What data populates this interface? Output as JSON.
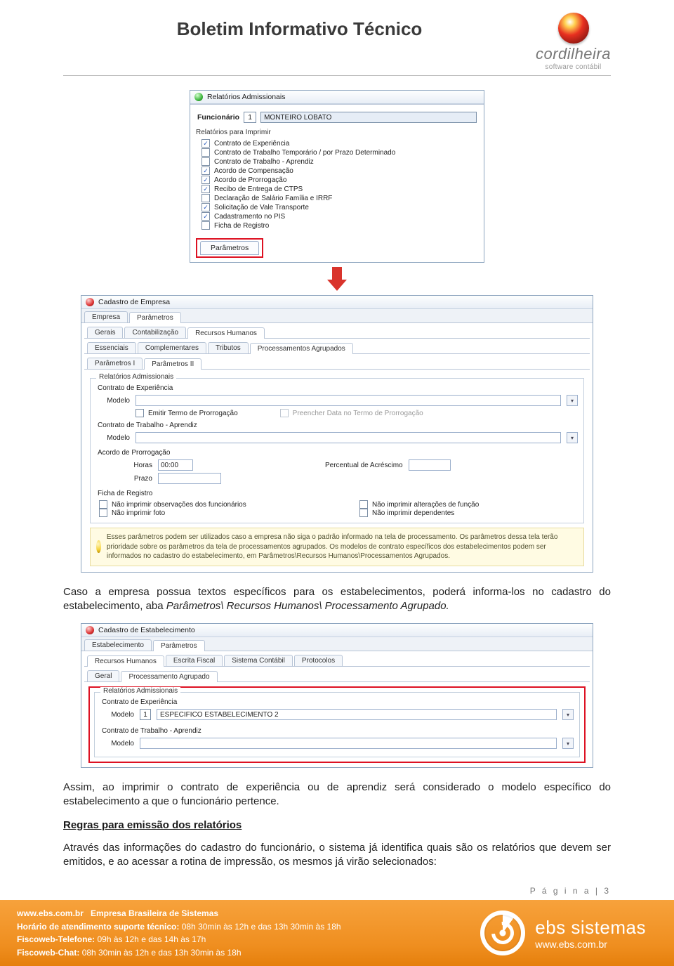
{
  "header": {
    "title": "Boletim Informativo Técnico"
  },
  "brand": {
    "name": "cordilheira",
    "sub": "software contábil"
  },
  "dlg1": {
    "title": "Relatórios Admissionais",
    "func_label": "Funcionário",
    "func_id": "1",
    "func_name": "MONTEIRO LOBATO",
    "list_caption": "Relatórios para Imprimir",
    "items": [
      {
        "label": "Contrato de Experiência",
        "checked": true
      },
      {
        "label": "Contrato de Trabalho Temporário / por Prazo Determinado",
        "checked": false
      },
      {
        "label": "Contrato de Trabalho - Aprendiz",
        "checked": false
      },
      {
        "label": "Acordo de Compensação",
        "checked": true
      },
      {
        "label": "Acordo de Prorrogação",
        "checked": true
      },
      {
        "label": "Recibo de Entrega de CTPS",
        "checked": true
      },
      {
        "label": "Declaração de Salário Família e IRRF",
        "checked": false
      },
      {
        "label": "Solicitação de Vale Transporte",
        "checked": true
      },
      {
        "label": "Cadastramento no PIS",
        "checked": true
      },
      {
        "label": "Ficha de Registro",
        "checked": false
      }
    ],
    "param_btn": "Parâmetros"
  },
  "dlg2": {
    "title": "Cadastro de Empresa",
    "tabs1": [
      "Empresa",
      "Parâmetros"
    ],
    "tabs2": [
      "Gerais",
      "Contabilização",
      "Recursos Humanos"
    ],
    "tabs3": [
      "Essenciais",
      "Complementares",
      "Tributos",
      "Processamentos Agrupados"
    ],
    "tabs4": [
      "Parâmetros I",
      "Parâmetros II"
    ],
    "active1": 1,
    "active2": 2,
    "active3": 3,
    "active4": 1,
    "fs_legend": "Relatórios Admissionais",
    "exp_caption": "Contrato de Experiência",
    "modelo_label": "Modelo",
    "chk_emitir": "Emitir Termo de Prorrogação",
    "chk_preencher": "Preencher Data no Termo de Prorrogação",
    "aprendiz_caption": "Contrato de Trabalho - Aprendiz",
    "acordo_caption": "Acordo de Prorrogação",
    "horas_label": "Horas",
    "horas_value": "00:00",
    "percentual_label": "Percentual de Acréscimo",
    "prazo_label": "Prazo",
    "ficha_caption": "Ficha de Registro",
    "ficha_checks_left": [
      "Não imprimir observações dos funcionários",
      "Não imprimir foto"
    ],
    "ficha_checks_right": [
      "Não imprimir alterações de função",
      "Não imprimir dependentes"
    ],
    "info": "Esses parâmetros podem ser utilizados caso a empresa não siga o padrão informado na tela de processamento. Os parâmetros dessa tela terão prioridade sobre os parâmetros da tela de processamentos agrupados. Os modelos de contrato específicos dos estabelecimentos podem ser informados no cadastro do estabelecimento, em Parâmetros\\Recursos Humanos\\Processamentos Agrupados."
  },
  "para1_a": "Caso a empresa possua textos específicos para os estabelecimentos, poderá informa-los no cadastro do estabelecimento, aba ",
  "para1_b": "Parâmetros\\ Recursos Humanos\\ Processamento Agrupado.",
  "dlg3": {
    "title": "Cadastro de Estabelecimento",
    "tabs1": [
      "Estabelecimento",
      "Parâmetros"
    ],
    "tabs2": [
      "Recursos Humanos",
      "Escrita Fiscal",
      "Sistema Contábil",
      "Protocolos"
    ],
    "tabs3": [
      "Geral",
      "Processamento Agrupado"
    ],
    "active1": 1,
    "active2": 0,
    "active3": 1,
    "fs_legend": "Relatórios Admissionais",
    "exp_caption": "Contrato de Experiência",
    "modelo_label": "Modelo",
    "modelo_id": "1",
    "modelo_value": "ESPECIFICO ESTABELECIMENTO 2",
    "aprendiz_caption": "Contrato de Trabalho - Aprendiz"
  },
  "para2": "Assim, ao imprimir o contrato de experiência ou de aprendiz será considerado o modelo específico do estabelecimento a que o funcionário pertence.",
  "heading": "Regras para emissão dos relatórios",
  "para3": "Através das informações do cadastro do funcionário, o sistema já identifica quais são os relatórios que devem ser emitidos, e ao acessar a rotina de impressão, os mesmos já virão selecionados:",
  "page_label": "P á g i n a | 3",
  "footer": {
    "url": "www.ebs.com.br",
    "company": "Empresa Brasileira de Sistemas",
    "l1a": "Horário de atendimento suporte técnico:",
    "l1b": "08h 30min às 12h e das 13h 30min às 18h",
    "l2a": "Fiscoweb-Telefone:",
    "l2b": "09h às 12h e das 14h às 17h",
    "l3a": "Fiscoweb-Chat:",
    "l3b": "08h 30min às 12h e das 13h 30min às 18h",
    "brand_name": "ebs sistemas",
    "brand_url": "www.ebs.com.br"
  }
}
